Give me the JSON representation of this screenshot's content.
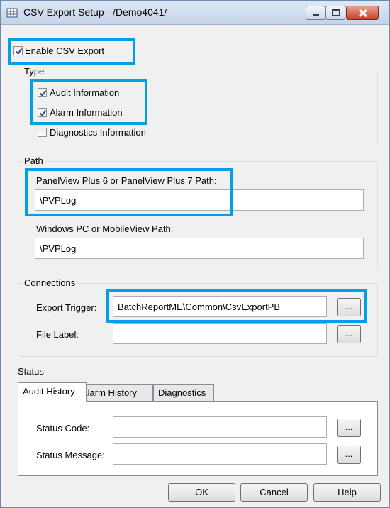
{
  "window": {
    "title": "CSV Export Setup - /Demo4041/"
  },
  "enable": {
    "label": "Enable CSV Export",
    "checked": true
  },
  "type": {
    "title": "Type",
    "options": [
      {
        "label": "Audit Information",
        "checked": true
      },
      {
        "label": "Alarm Information",
        "checked": true
      },
      {
        "label": "Diagnostics Information",
        "checked": false
      }
    ]
  },
  "path": {
    "title": "Path",
    "panelview_label": "PanelView Plus 6 or PanelView Plus 7 Path:",
    "panelview_value": "\\PVPLog",
    "windows_label": "Windows PC or MobileView Path:",
    "windows_value": "\\PVPLog"
  },
  "connections": {
    "title": "Connections",
    "export_trigger_label": "Export Trigger:",
    "export_trigger_value": "BatchReportME\\Common\\CsvExportPB",
    "file_label_label": "File Label:",
    "file_label_value": "",
    "browse_label": "..."
  },
  "status": {
    "title": "Status",
    "tabs": [
      "Audit History",
      "Alarm History",
      "Diagnostics"
    ],
    "active_tab": "Audit History",
    "status_code_label": "Status Code:",
    "status_code_value": "",
    "status_message_label": "Status Message:",
    "status_message_value": ""
  },
  "buttons": {
    "ok": "OK",
    "cancel": "Cancel",
    "help": "Help"
  },
  "colors": {
    "highlight": "#00a0e9",
    "dialog_bg": "#f0f0f0"
  }
}
